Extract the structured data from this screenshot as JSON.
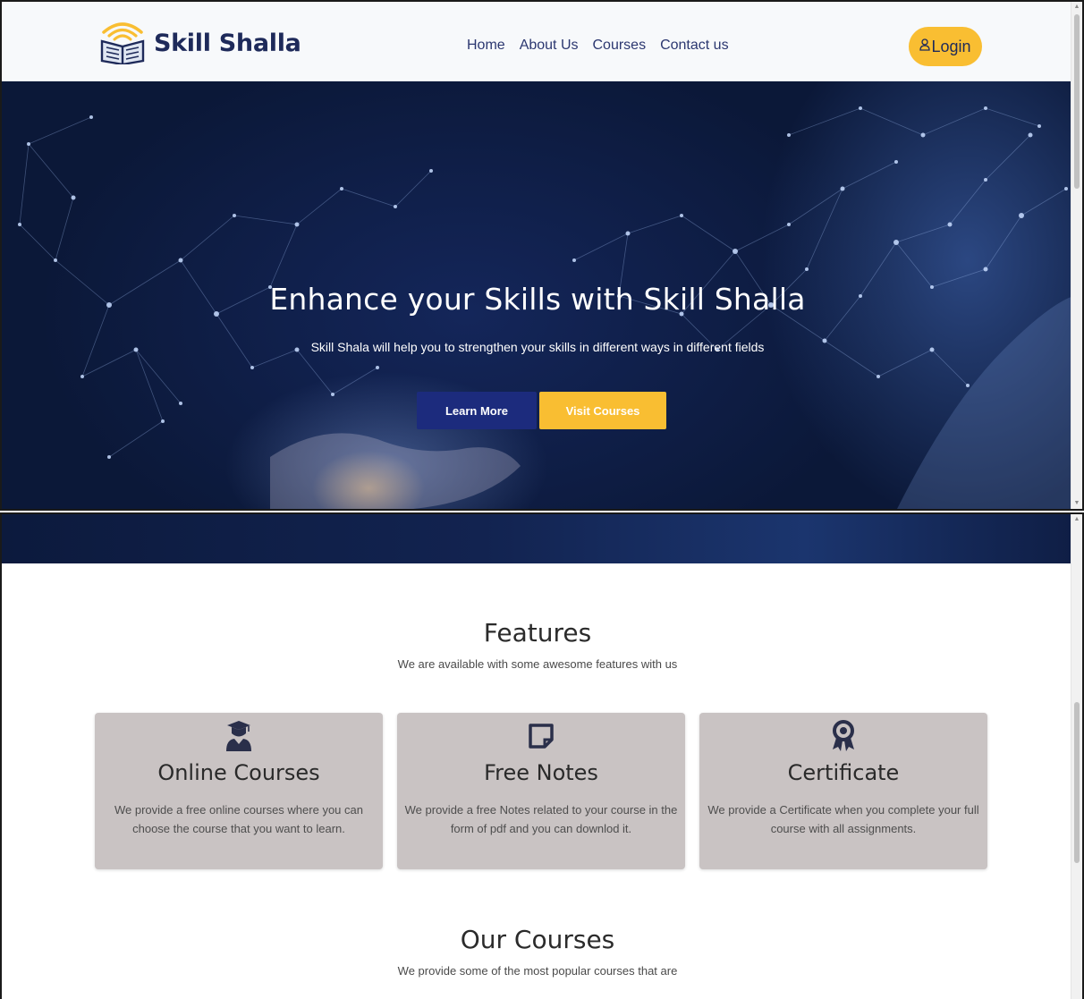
{
  "header": {
    "brand_name": "Skill Shalla",
    "brand_icon": "book-wifi-logo",
    "nav": [
      "Home",
      "About Us",
      "Courses",
      "Contact us"
    ],
    "login_label": "Login",
    "login_icon": "user-icon"
  },
  "hero": {
    "title": "Enhance your Skills with Skill Shalla",
    "subtitle": "Skill Shala will help you to strengthen your skills in different ways in different fields",
    "learn_more_label": "Learn More",
    "visit_courses_label": "Visit Courses"
  },
  "features": {
    "title": "Features",
    "subtitle": "We are available with some awesome features with us",
    "cards": [
      {
        "icon": "graduate-icon",
        "title": "Online Courses",
        "text": "We provide a free online courses where you can choose the course that you want to learn."
      },
      {
        "icon": "note-icon",
        "title": "Free Notes",
        "text": "We provide a free Notes related to your course in the form of pdf and you can downlod it."
      },
      {
        "icon": "award-icon",
        "title": "Certificate",
        "text": "We provide a Certificate when you complete your full course with all assignments."
      }
    ]
  },
  "courses": {
    "title": "Our Courses",
    "subtitle": "We provide some of the most popular courses that are"
  },
  "colors": {
    "brand_navy": "#1e2a5a",
    "accent_yellow": "#f9be32",
    "button_blue": "#1c2b7d",
    "card_bg": "#c9c3c3"
  }
}
